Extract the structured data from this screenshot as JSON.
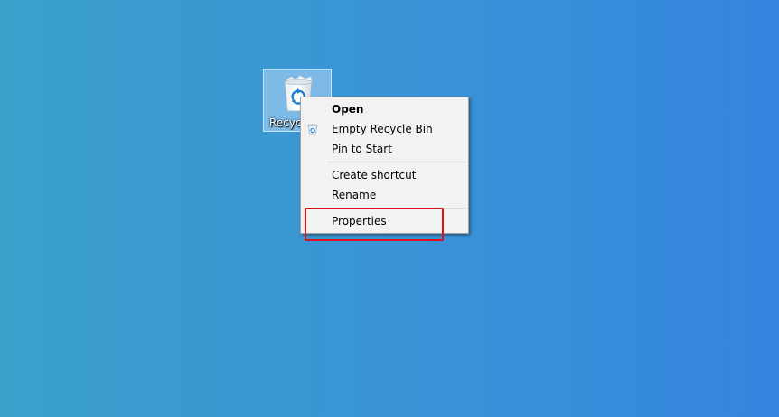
{
  "desktop": {
    "icon": {
      "label": "Recycle Bin",
      "icon_name": "recycle-bin-icon"
    }
  },
  "context_menu": {
    "items": [
      {
        "label": "Open",
        "bold": true
      },
      {
        "label": "Empty Recycle Bin",
        "icon_name": "recycle-bin-small-icon"
      },
      {
        "label": "Pin to Start"
      },
      {
        "label": "Create shortcut"
      },
      {
        "label": "Rename"
      },
      {
        "label": "Properties",
        "highlighted": true
      }
    ]
  },
  "colors": {
    "desktop_background": "#3a93d6",
    "menu_background": "#f2f2f2",
    "highlight": "#e0101a"
  }
}
